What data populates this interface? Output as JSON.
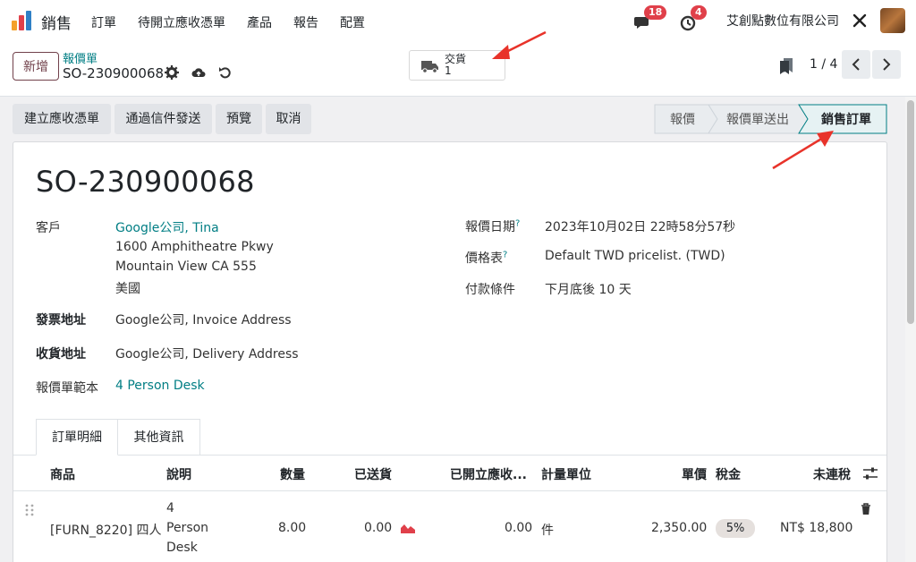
{
  "navbar": {
    "app_name": "銷售",
    "menu": [
      "訂單",
      "待開立應收憑單",
      "產品",
      "報告",
      "配置"
    ],
    "messages_count": "18",
    "activities_count": "4",
    "company": "艾創點數位有限公司"
  },
  "control": {
    "new_label": "新增",
    "breadcrumb_parent": "報價單",
    "breadcrumb_record": "SO-230900068",
    "smart_delivery_label": "交貨",
    "smart_delivery_count": "1",
    "pager": "1 / 4"
  },
  "actions": {
    "create_invoice": "建立應收憑單",
    "send_email": "通過信件發送",
    "preview": "預覽",
    "cancel": "取消"
  },
  "status": {
    "stages": [
      "報價",
      "報價單送出",
      "銷售訂單"
    ],
    "current": "銷售訂單"
  },
  "form": {
    "title": "SO-230900068",
    "customer_label": "客戶",
    "customer": "Google公司, Tina",
    "address_1": "1600 Amphitheatre Pkwy",
    "address_2": "Mountain View CA 555",
    "address_3": "美國",
    "invoice_address_label": "發票地址",
    "invoice_address": "Google公司, Invoice Address",
    "delivery_address_label": "收貨地址",
    "delivery_address": "Google公司, Delivery Address",
    "template_label": "報價單範本",
    "template": "4 Person Desk",
    "quote_date_label": "報價日期",
    "quote_date": "2023年10月02日 22時58分57秒",
    "pricelist_label": "價格表",
    "pricelist": "Default TWD pricelist. (TWD)",
    "payment_terms_label": "付款條件",
    "payment_terms": "下月底後 10 天",
    "help_mark": "?"
  },
  "tabs": [
    "訂單明細",
    "其他資訊"
  ],
  "lines": {
    "headers": [
      "商品",
      "說明",
      "數量",
      "已送貨",
      "已開立應收...",
      "計量單位",
      "單價",
      "稅金",
      "未連稅"
    ],
    "rows": [
      {
        "product": "[FURN_8220] 四人",
        "description_1": "4",
        "description_2": "Person",
        "description_3": "Desk",
        "quantity": "8.00",
        "delivered": "0.00",
        "invoiced": "0.00",
        "uom": "件",
        "unit_price": "2,350.00",
        "tax": "5%",
        "subtotal": "NT$ 18,800"
      }
    ]
  },
  "colors": {
    "brand": "#71414b",
    "link": "#017e84",
    "badge": "#e0404a",
    "annotation_arrow": "#e8332a"
  }
}
